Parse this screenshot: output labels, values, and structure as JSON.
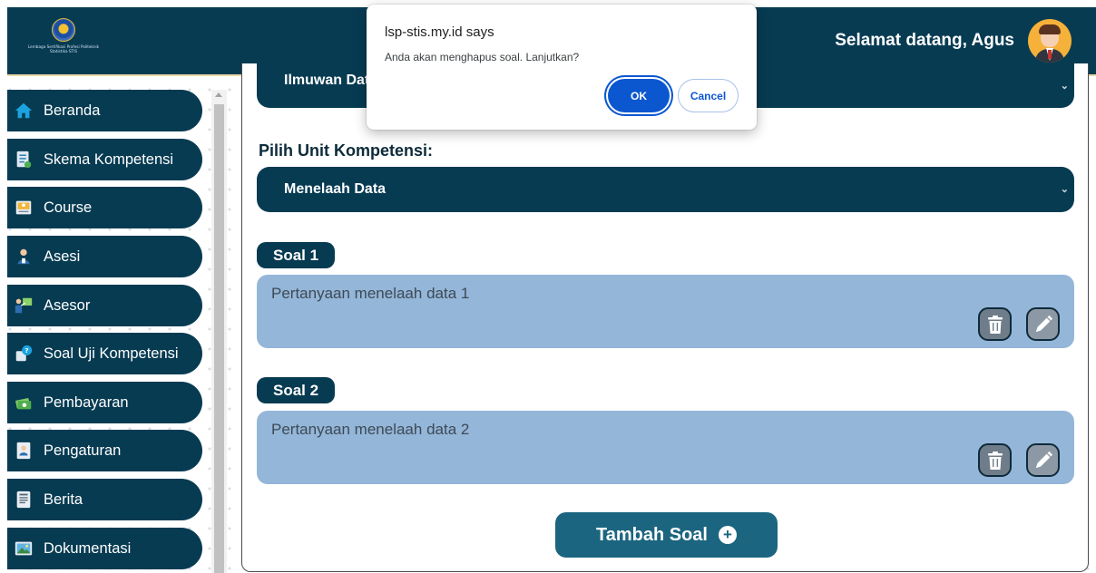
{
  "header": {
    "logo_caption": "Lembaga Sertifikasi Profesi Politeknik Statistika STIS",
    "welcome": "Selamat datang, Agus"
  },
  "sidebar": {
    "items": [
      {
        "label": "Beranda",
        "icon": "home-icon"
      },
      {
        "label": "Skema Kompetensi",
        "icon": "document-icon"
      },
      {
        "label": "Course",
        "icon": "course-icon"
      },
      {
        "label": "Asesi",
        "icon": "user-icon"
      },
      {
        "label": "Asesor",
        "icon": "teacher-icon"
      },
      {
        "label": "Soal Uji Kompetensi",
        "icon": "quiz-icon"
      },
      {
        "label": "Pembayaran",
        "icon": "money-icon"
      },
      {
        "label": "Pengaturan",
        "icon": "settings-icon"
      },
      {
        "label": "Berita",
        "icon": "news-icon"
      },
      {
        "label": "Dokumentasi",
        "icon": "image-icon"
      }
    ]
  },
  "main": {
    "scheme_select_value": "Ilmuwan Data",
    "unit_label": "Pilih Unit Kompetensi:",
    "unit_select_value": "Menelaah Data",
    "questions": [
      {
        "tag": "Soal 1",
        "text": "Pertanyaan menelaah data 1"
      },
      {
        "tag": "Soal 2",
        "text": "Pertanyaan menelaah data 2"
      }
    ],
    "add_button": "Tambah Soal"
  },
  "dialog": {
    "title": "lsp-stis.my.id says",
    "message": "Anda akan menghapus soal. Lanjutkan?",
    "ok_label": "OK",
    "cancel_label": "Cancel"
  },
  "colors": {
    "primary": "#073b52",
    "question_bg": "#94b6d9",
    "add_button": "#1b6580",
    "dialog_accent": "#0b57d0"
  }
}
